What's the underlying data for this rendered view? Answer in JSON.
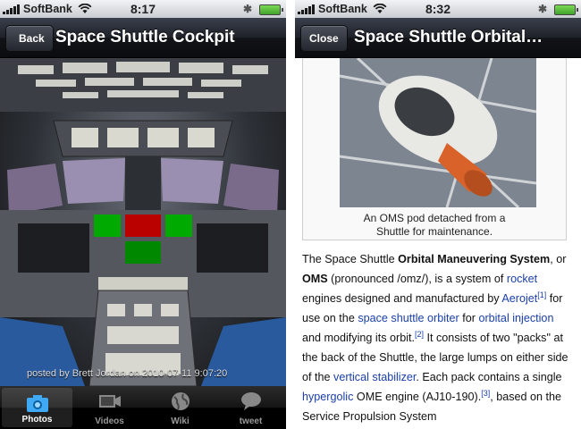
{
  "left": {
    "status": {
      "carrier": "SoftBank",
      "time": "8:17"
    },
    "nav": {
      "back_label": "Back",
      "title": "Space Shuttle Cockpit"
    },
    "photo_caption": "posted by Brett Jordan on 2010-07-11 9:07:20",
    "tabs": [
      {
        "label": "Photos",
        "icon": "camera-icon"
      },
      {
        "label": "Videos",
        "icon": "film-icon"
      },
      {
        "label": "Wiki",
        "icon": "globe-icon"
      },
      {
        "label": "tweet",
        "icon": "speech-bubble-icon"
      }
    ]
  },
  "right": {
    "status": {
      "carrier": "SoftBank",
      "time": "8:32"
    },
    "nav": {
      "close_label": "Close",
      "title": "Space Shuttle Orbital…"
    },
    "thumb_caption_1": "An OMS pod detached from a",
    "thumb_caption_2": "Shuttle for maintenance.",
    "article": {
      "p1": "The Space Shuttle ",
      "bold1": "Orbital Maneuvering System",
      "p2": ", or ",
      "bold2": "OMS",
      "p3": " (pronounced /omz/), is a system of ",
      "link_rocket": "rocket",
      "p4": " engines designed and manufactured by ",
      "link_aerojet": "Aerojet",
      "ref1": "[1]",
      "p5": " for use on the ",
      "link_orbiter": "space shuttle orbiter",
      "p6": " for ",
      "link_injection": "orbital injection",
      "p7": " and modifying its orbit.",
      "ref2": "[2]",
      "p8": " It consists of two \"packs\" at the back of the Shuttle, the large lumps on either side of the ",
      "link_stabilizer": "vertical stabilizer",
      "p9": ". Each pack contains a single ",
      "link_hypergolic": "hypergolic",
      "p10": " OME engine (AJ10-190).",
      "ref3": "[3]",
      "p11": ", based on the Service Propulsion System"
    }
  },
  "colors": {
    "link": "#1a3fa8",
    "navbar": "#1e2128"
  }
}
